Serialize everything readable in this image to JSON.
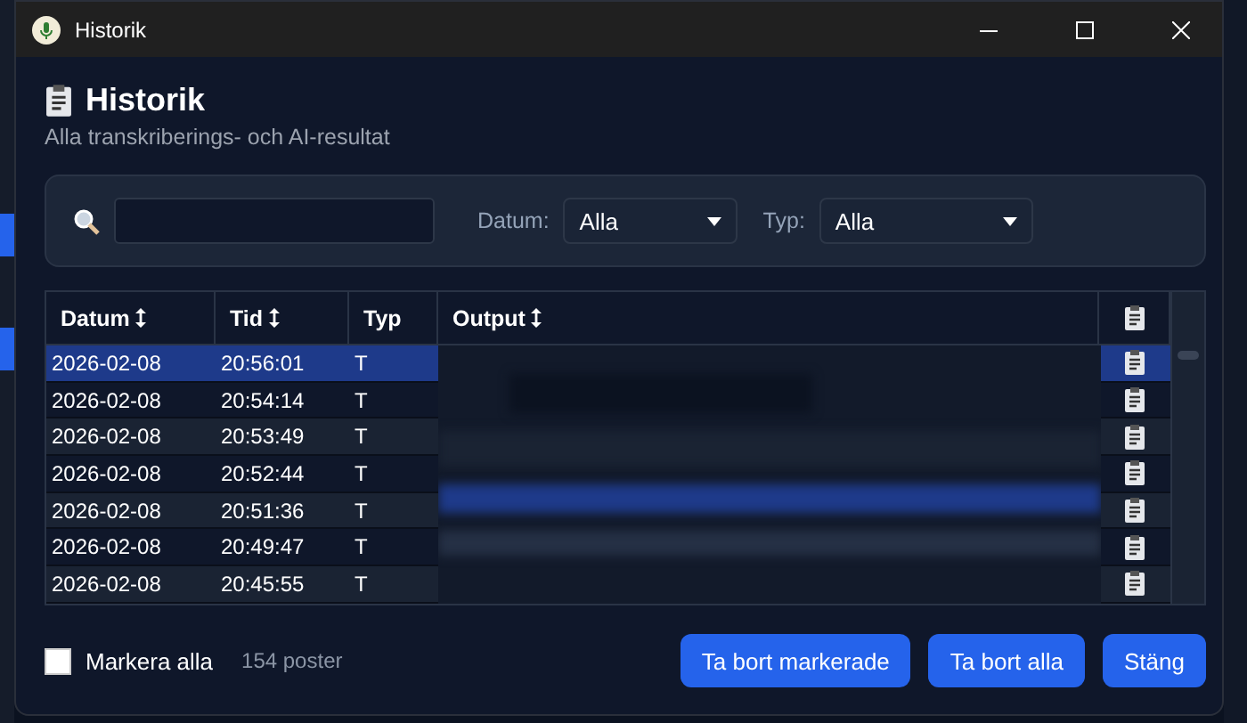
{
  "window": {
    "title": "Historik"
  },
  "header": {
    "title": "Historik",
    "subtitle": "Alla transkriberings- och AI-resultat"
  },
  "filters": {
    "date_filter": {
      "label": "Datum:",
      "value": "Alla"
    },
    "type_filter": {
      "label": "Typ:",
      "value": "Alla"
    }
  },
  "table": {
    "columns": [
      {
        "kind": "text",
        "label": "Datum",
        "sortable": true
      },
      {
        "kind": "text",
        "label": "Tid",
        "sortable": true
      },
      {
        "kind": "text",
        "label": "Typ",
        "sortable": false
      },
      {
        "kind": "text",
        "label": "Output",
        "sortable": true
      },
      {
        "kind": "icon"
      }
    ],
    "rows": [
      {
        "date": "2026-02-08",
        "time": "20:56:01",
        "type": "T",
        "selected": true
      },
      {
        "date": "2026-02-08",
        "time": "20:54:14",
        "type": "T",
        "selected": false
      },
      {
        "date": "2026-02-08",
        "time": "20:53:49",
        "type": "T",
        "selected": false
      },
      {
        "date": "2026-02-08",
        "time": "20:52:44",
        "type": "T",
        "selected": false
      },
      {
        "date": "2026-02-08",
        "time": "20:51:36",
        "type": "T",
        "selected": false
      },
      {
        "date": "2026-02-08",
        "time": "20:49:47",
        "type": "T",
        "selected": false
      },
      {
        "date": "2026-02-08",
        "time": "20:45:55",
        "type": "T",
        "selected": false
      }
    ]
  },
  "footer": {
    "select_all": {
      "label": "Markera alla",
      "checked": false
    },
    "count": "154 poster",
    "buttons": [
      "Ta bort markerade",
      "Ta bort alla",
      "Stäng"
    ]
  }
}
